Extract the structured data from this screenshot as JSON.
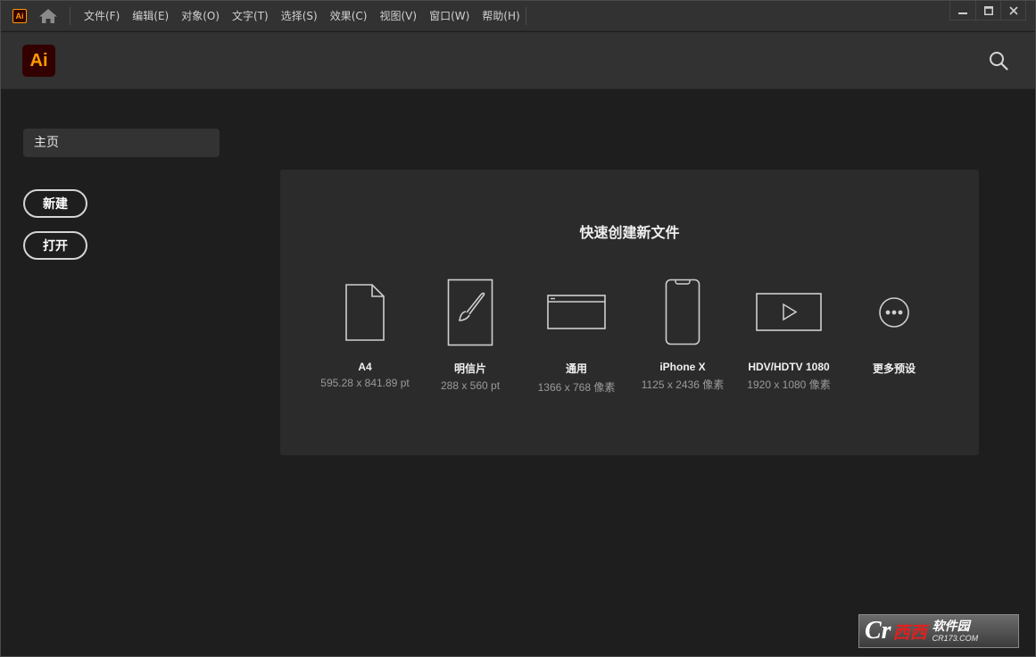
{
  "app": {
    "mini_logo": "Ai",
    "logo": "Ai",
    "brand_color": "#ff9a00",
    "logo_bg": "#330000"
  },
  "menu": {
    "items": [
      {
        "label": "文件(F)"
      },
      {
        "label": "编辑(E)"
      },
      {
        "label": "对象(O)"
      },
      {
        "label": "文字(T)"
      },
      {
        "label": "选择(S)"
      },
      {
        "label": "效果(C)"
      },
      {
        "label": "视图(V)"
      },
      {
        "label": "窗口(W)"
      },
      {
        "label": "帮助(H)"
      }
    ]
  },
  "window_controls": {
    "minimize": "minimize-icon",
    "maximize": "maximize-icon",
    "close": "close-icon"
  },
  "header": {
    "search_icon": "search-icon"
  },
  "sidebar": {
    "home_tab": "主页",
    "new_button": "新建",
    "open_button": "打开"
  },
  "quick_create": {
    "title": "快速创建新文件",
    "presets": [
      {
        "name": "A4",
        "size": "595.28 x 841.89 pt",
        "icon": "document-icon"
      },
      {
        "name": "明信片",
        "size": "288 x 560 pt",
        "icon": "brush-card-icon"
      },
      {
        "name": "通用",
        "size": "1366 x 768 像素",
        "icon": "browser-window-icon"
      },
      {
        "name": "iPhone X",
        "size": "1125 x 2436 像素",
        "icon": "phone-icon"
      },
      {
        "name": "HDV/HDTV 1080",
        "size": "1920 x 1080 像素",
        "icon": "video-play-icon"
      },
      {
        "name": "更多预设",
        "size": "",
        "icon": "more-icon"
      }
    ]
  },
  "watermark": {
    "cr": "Cr",
    "red": "西西",
    "soft": "软件园",
    "url": "CR173.COM"
  }
}
